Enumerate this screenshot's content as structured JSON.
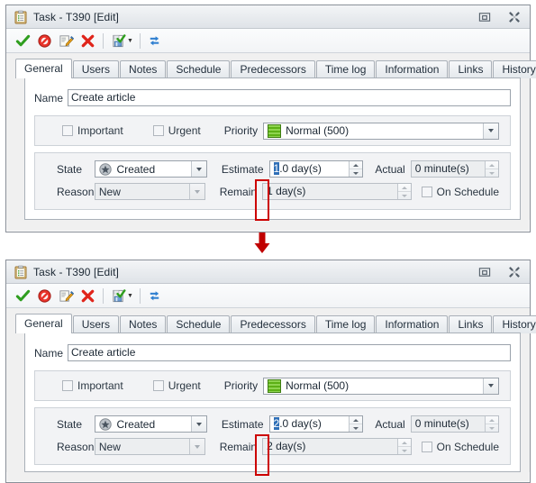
{
  "panels": [
    {
      "window": {
        "title": "Task - T390 [Edit]",
        "icon": "clipboard-icon",
        "buttons": {
          "restore": "restore-icon",
          "close": "close-icon"
        }
      },
      "toolbar": {
        "items": [
          {
            "name": "accept-button",
            "icon": "green-check-icon"
          },
          {
            "name": "reject-button",
            "icon": "red-prohibit-icon"
          },
          {
            "name": "edit-button",
            "icon": "pencil-note-icon"
          },
          {
            "name": "delete-button",
            "icon": "red-x-icon"
          },
          {
            "name": "separator",
            "icon": "separator"
          },
          {
            "name": "save-report-button",
            "icon": "document-check-icon",
            "has_caret": true
          },
          {
            "name": "refresh-button",
            "icon": "blue-refresh-icon"
          }
        ]
      },
      "tabs": [
        {
          "label": "General",
          "active": true
        },
        {
          "label": "Users",
          "active": false
        },
        {
          "label": "Notes",
          "active": false
        },
        {
          "label": "Schedule",
          "active": false
        },
        {
          "label": "Predecessors",
          "active": false
        },
        {
          "label": "Time log",
          "active": false
        },
        {
          "label": "Information",
          "active": false
        },
        {
          "label": "Links",
          "active": false
        },
        {
          "label": "History",
          "active": false
        }
      ],
      "form": {
        "name_label": "Name",
        "name_value": "Create article",
        "important_label": "Important",
        "important_checked": false,
        "urgent_label": "Urgent",
        "urgent_checked": false,
        "priority_label": "Priority",
        "priority_value": "Normal (500)",
        "state_label": "State",
        "state_value": "Created",
        "reason_label": "Reason",
        "reason_value": "New",
        "estimate_label": "Estimate",
        "estimate_selected_digit": "1",
        "estimate_rest": ".0 day(s)",
        "actual_label": "Actual",
        "actual_value": "0 minute(s)",
        "remain_label": "Remain",
        "remain_value": "1 day(s)",
        "on_schedule_label": "On Schedule",
        "on_schedule_checked": false
      }
    },
    {
      "window": {
        "title": "Task - T390 [Edit]",
        "icon": "clipboard-icon",
        "buttons": {
          "restore": "restore-icon",
          "close": "close-icon"
        }
      },
      "toolbar": {
        "items": [
          {
            "name": "accept-button",
            "icon": "green-check-icon"
          },
          {
            "name": "reject-button",
            "icon": "red-prohibit-icon"
          },
          {
            "name": "edit-button",
            "icon": "pencil-note-icon"
          },
          {
            "name": "delete-button",
            "icon": "red-x-icon"
          },
          {
            "name": "separator",
            "icon": "separator"
          },
          {
            "name": "save-report-button",
            "icon": "document-check-icon",
            "has_caret": true
          },
          {
            "name": "refresh-button",
            "icon": "blue-refresh-icon"
          }
        ]
      },
      "tabs": [
        {
          "label": "General",
          "active": true
        },
        {
          "label": "Users",
          "active": false
        },
        {
          "label": "Notes",
          "active": false
        },
        {
          "label": "Schedule",
          "active": false
        },
        {
          "label": "Predecessors",
          "active": false
        },
        {
          "label": "Time log",
          "active": false
        },
        {
          "label": "Information",
          "active": false
        },
        {
          "label": "Links",
          "active": false
        },
        {
          "label": "History",
          "active": false
        }
      ],
      "form": {
        "name_label": "Name",
        "name_value": "Create article",
        "important_label": "Important",
        "important_checked": false,
        "urgent_label": "Urgent",
        "urgent_checked": false,
        "priority_label": "Priority",
        "priority_value": "Normal (500)",
        "state_label": "State",
        "state_value": "Created",
        "reason_label": "Reason",
        "reason_value": "New",
        "estimate_label": "Estimate",
        "estimate_selected_digit": "2",
        "estimate_rest": ".0 day(s)",
        "actual_label": "Actual",
        "actual_value": "0 minute(s)",
        "remain_label": "Remain",
        "remain_value": "2 day(s)",
        "on_schedule_label": "On Schedule",
        "on_schedule_checked": false
      }
    }
  ],
  "annotation": {
    "arrow_icon": "red-down-arrow",
    "highlight_color": "#cc0000",
    "selection_color": "#2f6fb7"
  }
}
